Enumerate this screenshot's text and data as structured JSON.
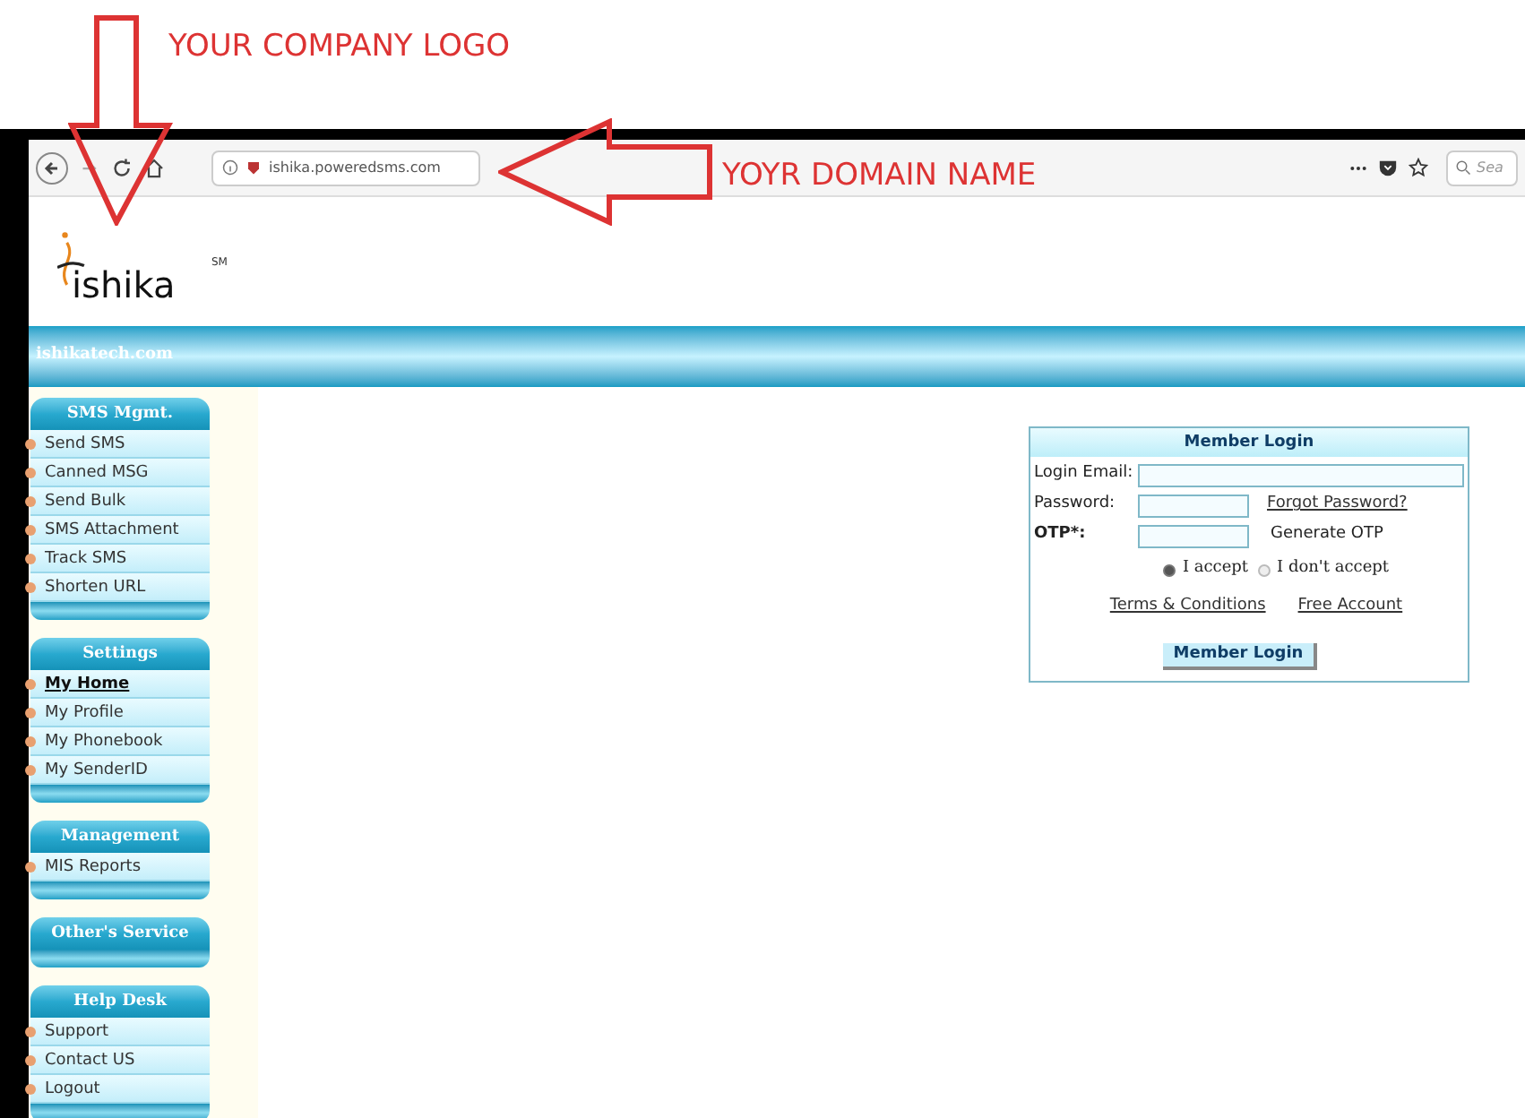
{
  "annotations": [
    {
      "text": "YOUR COMPANY LOGO"
    },
    {
      "text": "YOYR DOMAIN NAME"
    }
  ],
  "browser": {
    "url": "ishika.poweredsms.com",
    "search_placeholder": "Sea"
  },
  "site": {
    "logo": "ishika",
    "logo_mark": "SM",
    "banner": "ishikatech.com"
  },
  "sidebar": [
    {
      "title": "SMS Mgmt.",
      "items": [
        {
          "label": "Send SMS",
          "selected": false
        },
        {
          "label": "Canned MSG",
          "selected": false
        },
        {
          "label": "Send Bulk",
          "selected": false
        },
        {
          "label": "SMS Attachment",
          "selected": false
        },
        {
          "label": "Track SMS",
          "selected": false
        },
        {
          "label": "Shorten URL",
          "selected": false
        }
      ]
    },
    {
      "title": "Settings",
      "items": [
        {
          "label": "My Home",
          "selected": true
        },
        {
          "label": "My Profile",
          "selected": false
        },
        {
          "label": "My Phonebook",
          "selected": false
        },
        {
          "label": "My SenderID",
          "selected": false
        }
      ]
    },
    {
      "title": "Management",
      "items": [
        {
          "label": "MIS Reports",
          "selected": false
        }
      ]
    },
    {
      "title": "Other's Service"
    },
    {
      "title": "Help Desk",
      "items": [
        {
          "label": "Support",
          "selected": false
        },
        {
          "label": "Contact US",
          "selected": false
        },
        {
          "label": "Logout",
          "selected": false
        }
      ]
    }
  ],
  "login": {
    "title": "Member Login",
    "fields": [
      {
        "label": "Login Email:",
        "bold": false,
        "kind": "wide"
      },
      {
        "label": "Password:",
        "bold": false,
        "kind": "link",
        "extra": "Forgot Password?"
      },
      {
        "label": "OTP*:",
        "bold": true,
        "kind": "note",
        "extra": "Generate OTP"
      }
    ],
    "radios": [
      {
        "label": "I accept",
        "selected": true
      },
      {
        "label": "I don't accept",
        "selected": false
      }
    ],
    "links": [
      "Terms & Conditions",
      "Free Account"
    ],
    "button": "Member Login"
  }
}
